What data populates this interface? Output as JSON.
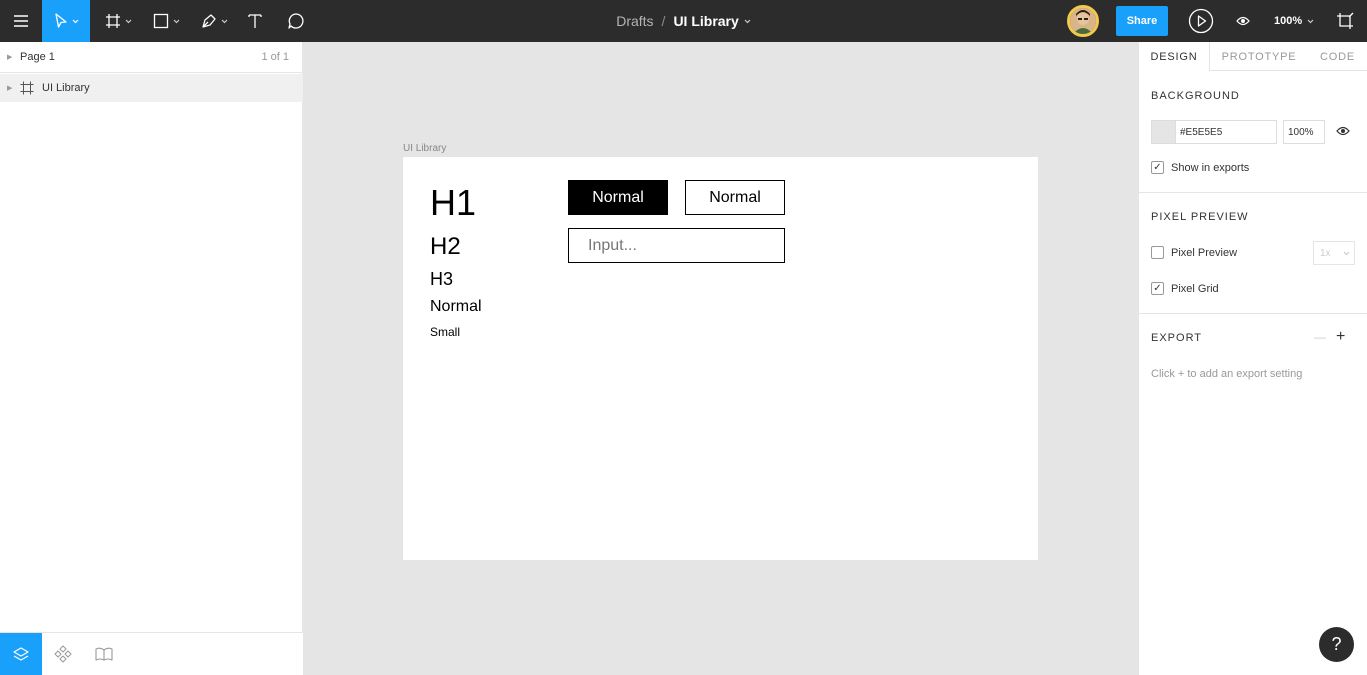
{
  "toolbar": {
    "breadcrumb_root": "Drafts",
    "breadcrumb_separator": "/",
    "file_name": "UI Library",
    "share_label": "Share",
    "zoom_label": "100%",
    "accent_color": "#18a0fb",
    "tools": [
      "menu-icon",
      "move-tool-icon",
      "frame-tool-icon",
      "rectangle-tool-icon",
      "pen-tool-icon",
      "text-tool-icon",
      "comment-tool-icon"
    ]
  },
  "left_panel": {
    "page_name": "Page 1",
    "page_count": "1 of 1",
    "layers": [
      {
        "name": "UI Library",
        "icon": "frame-icon"
      }
    ],
    "bottom_tabs": [
      "layers-icon",
      "components-icon",
      "library-icon"
    ]
  },
  "canvas": {
    "frame_label": "UI Library",
    "background": "#e5e5e5",
    "texts": {
      "h1": "H1",
      "h2": "H2",
      "h3": "H3",
      "normal": "Normal",
      "small": "Small"
    },
    "buttons": {
      "filled_label": "Normal",
      "outline_label": "Normal"
    },
    "input_placeholder": "Input..."
  },
  "right_panel": {
    "tabs": [
      "DESIGN",
      "PROTOTYPE",
      "CODE"
    ],
    "active_tab": "DESIGN",
    "background": {
      "title": "BACKGROUND",
      "hex": "#E5E5E5",
      "opacity": "100%",
      "show_in_exports_label": "Show in exports",
      "show_in_exports": true
    },
    "pixel_preview": {
      "title": "PIXEL PREVIEW",
      "preview_label": "Pixel Preview",
      "preview_checked": false,
      "scale": "1x",
      "grid_label": "Pixel Grid",
      "grid_checked": true
    },
    "export": {
      "title": "EXPORT",
      "hint": "Click + to add an export setting"
    }
  },
  "help_label": "?"
}
